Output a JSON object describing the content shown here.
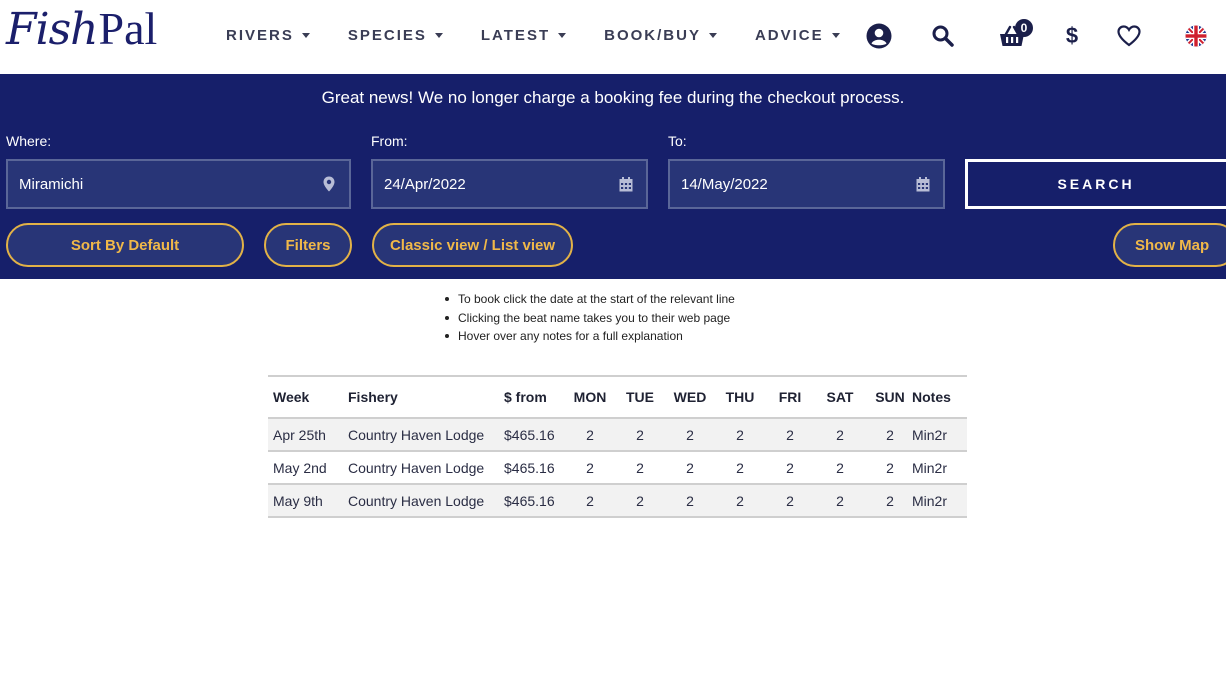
{
  "logo": {
    "part1": "Fish",
    "part2": "Pal"
  },
  "nav": [
    {
      "label": "RIVERS"
    },
    {
      "label": "SPECIES"
    },
    {
      "label": "LATEST"
    },
    {
      "label": "BOOK/BUY"
    },
    {
      "label": "ADVICE"
    }
  ],
  "header_icons": {
    "account": "user-icon",
    "search": "search-icon",
    "basket": "basket-icon",
    "basket_count": "0",
    "currency": "$",
    "wishlist": "heart-icon",
    "language": "uk-flag-icon"
  },
  "notice": "Great news! We no longer charge a booking fee during the checkout process.",
  "search_form": {
    "where_label": "Where:",
    "where_value": "Miramichi",
    "from_label": "From:",
    "from_value": "24/Apr/2022",
    "to_label": "To:",
    "to_value": "14/May/2022",
    "search_button": "SEARCH"
  },
  "controls": {
    "sort": "Sort By Default",
    "filters": "Filters",
    "view": "Classic view / List view",
    "map": "Show Map"
  },
  "instructions": [
    "To book click the date at the start of the relevant line",
    "Clicking the beat name takes you to their web page",
    "Hover over any notes for a full explanation"
  ],
  "table": {
    "headers": [
      "Week",
      "Fishery",
      "$ from",
      "MON",
      "TUE",
      "WED",
      "THU",
      "FRI",
      "SAT",
      "SUN",
      "Notes"
    ],
    "rows": [
      [
        "Apr 25th",
        "Country Haven Lodge",
        "$465.16",
        "2",
        "2",
        "2",
        "2",
        "2",
        "2",
        "2",
        "Min2r"
      ],
      [
        "May 2nd",
        "Country Haven Lodge",
        "$465.16",
        "2",
        "2",
        "2",
        "2",
        "2",
        "2",
        "2",
        "Min2r"
      ],
      [
        "May 9th",
        "Country Haven Lodge",
        "$465.16",
        "2",
        "2",
        "2",
        "2",
        "2",
        "2",
        "2",
        "Min2r"
      ]
    ]
  },
  "colors": {
    "brand_navy": "#161f6a",
    "field_bg": "#283577",
    "accent_gold": "#f0b849"
  }
}
